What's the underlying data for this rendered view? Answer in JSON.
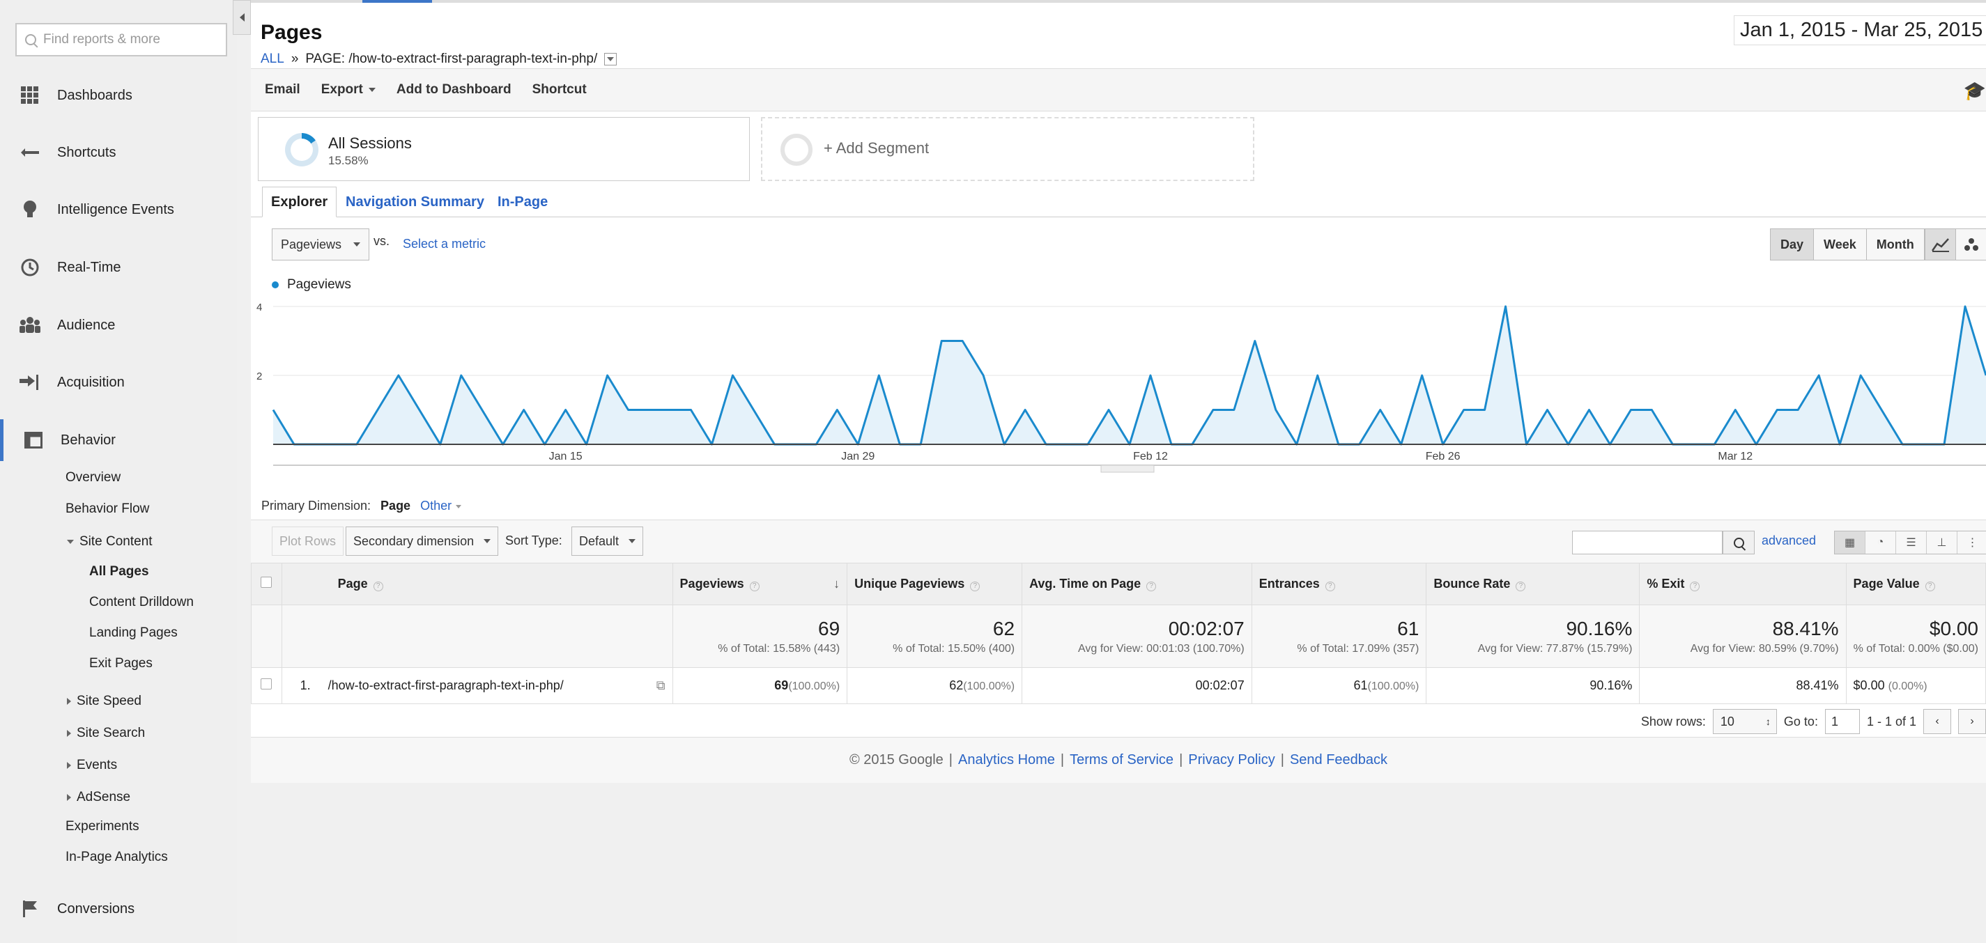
{
  "sidebar": {
    "search_placeholder": "Find reports & more",
    "nav": [
      {
        "label": "Dashboards",
        "icon": "grid-icon"
      },
      {
        "label": "Shortcuts",
        "icon": "shortcut-arrow-icon"
      },
      {
        "label": "Intelligence Events",
        "icon": "lightbulb-icon"
      },
      {
        "label": "Real-Time",
        "icon": "clock-icon"
      },
      {
        "label": "Audience",
        "icon": "people-icon"
      },
      {
        "label": "Acquisition",
        "icon": "acquisition-arrow-icon"
      },
      {
        "label": "Behavior",
        "icon": "behavior-window-icon"
      },
      {
        "label": "Conversions",
        "icon": "flag-icon"
      }
    ],
    "behavior_items": {
      "overview": "Overview",
      "behavior_flow": "Behavior Flow",
      "site_content": "Site Content",
      "all_pages": "All Pages",
      "content_drilldown": "Content Drilldown",
      "landing_pages": "Landing Pages",
      "exit_pages": "Exit Pages",
      "site_speed": "Site Speed",
      "site_search": "Site Search",
      "events": "Events",
      "adsense": "AdSense",
      "experiments": "Experiments",
      "in_page_analytics": "In-Page Analytics"
    }
  },
  "header": {
    "title": "Pages",
    "crumb_all": "ALL",
    "crumb_sep": "»",
    "crumb_page": "PAGE: /how-to-extract-first-paragraph-text-in-php/",
    "date_start": "Jan 1, 2015",
    "date_sep": "-",
    "date_end": "Mar 25, 2015"
  },
  "toolbar": {
    "email": "Email",
    "export": "Export",
    "add_dashboard": "Add to Dashboard",
    "shortcut": "Shortcut"
  },
  "segments": {
    "all_sessions": "All Sessions",
    "all_sessions_pct": "15.58%",
    "add_segment": "+ Add Segment"
  },
  "tabs": {
    "explorer": "Explorer",
    "nav_summary": "Navigation Summary",
    "in_page": "In-Page"
  },
  "metric": {
    "selected": "Pageviews",
    "vs": "vs.",
    "select_metric": "Select a metric",
    "granularity": {
      "day": "Day",
      "week": "Week",
      "month": "Month"
    },
    "legend": "Pageviews"
  },
  "chart_data": {
    "type": "area",
    "series": [
      {
        "name": "Pageviews",
        "color": "#1a8acd"
      }
    ],
    "ylim": [
      0,
      4
    ],
    "yticks": [
      "2",
      "4"
    ],
    "xticks": [
      {
        "label": "Jan 15",
        "index": 14
      },
      {
        "label": "Jan 29",
        "index": 28
      },
      {
        "label": "Feb 12",
        "index": 42
      },
      {
        "label": "Feb 26",
        "index": 56
      },
      {
        "label": "Mar 12",
        "index": 70
      }
    ],
    "values": [
      1,
      0,
      0,
      0,
      0,
      1,
      2,
      1,
      0,
      2,
      1,
      0,
      1,
      0,
      1,
      0,
      2,
      1,
      1,
      1,
      1,
      0,
      2,
      1,
      0,
      0,
      0,
      1,
      0,
      2,
      0,
      0,
      3,
      3,
      2,
      0,
      1,
      0,
      0,
      0,
      1,
      0,
      2,
      0,
      0,
      1,
      1,
      3,
      1,
      0,
      2,
      0,
      0,
      1,
      0,
      2,
      0,
      1,
      1,
      4,
      0,
      1,
      0,
      1,
      0,
      1,
      1,
      0,
      0,
      0,
      1,
      0,
      1,
      1,
      2,
      0,
      2,
      1,
      0,
      0,
      0,
      4,
      2
    ]
  },
  "table_controls": {
    "primary_dimension_label": "Primary Dimension:",
    "primary_dimension": "Page",
    "other": "Other",
    "plot_rows": "Plot Rows",
    "secondary_dimension": "Secondary dimension",
    "sort_type_label": "Sort Type:",
    "sort_type": "Default",
    "advanced": "advanced"
  },
  "table": {
    "headers": [
      "Page",
      "Pageviews",
      "Unique Pageviews",
      "Avg. Time on Page",
      "Entrances",
      "Bounce Rate",
      "% Exit",
      "Page Value"
    ],
    "totals": [
      {
        "value": "69",
        "sub": "% of Total: 15.58% (443)"
      },
      {
        "value": "62",
        "sub": "% of Total: 15.50% (400)"
      },
      {
        "value": "00:02:07",
        "sub": "Avg for View: 00:01:03 (100.70%)"
      },
      {
        "value": "61",
        "sub": "% of Total: 17.09% (357)"
      },
      {
        "value": "90.16%",
        "sub": "Avg for View: 77.87% (15.79%)"
      },
      {
        "value": "88.41%",
        "sub": "Avg for View: 80.59% (9.70%)"
      },
      {
        "value": "$0.00",
        "sub": "% of Total: 0.00% ($0.00)"
      }
    ],
    "row": {
      "num": "1.",
      "page": "/how-to-extract-first-paragraph-text-in-php/",
      "pageviews": "69",
      "pageviews_pct": "(100.00%)",
      "unique": "62",
      "unique_pct": "(100.00%)",
      "avg_time": "00:02:07",
      "entrances": "61",
      "entrances_pct": "(100.00%)",
      "bounce": "90.16%",
      "exit": "88.41%",
      "value": "$0.00",
      "value_pct": "(0.00%)"
    }
  },
  "pager": {
    "show_rows": "Show rows:",
    "rows": "10",
    "goto": "Go to:",
    "goto_value": "1",
    "range": "1 - 1 of 1"
  },
  "footer": {
    "copyright": "© 2015 Google",
    "sep": "|",
    "analytics_home": "Analytics Home",
    "terms": "Terms of Service",
    "privacy": "Privacy Policy",
    "feedback": "Send Feedback"
  }
}
